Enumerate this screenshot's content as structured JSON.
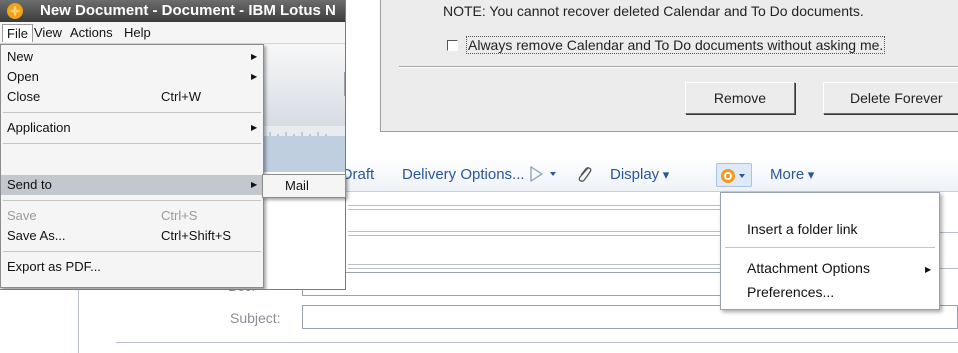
{
  "window": {
    "title": "New Document - Document - IBM Lotus N"
  },
  "menubar": {
    "items": [
      {
        "label": "File",
        "active": true
      },
      {
        "label": "View",
        "active": false
      },
      {
        "label": "Actions",
        "active": false
      },
      {
        "label": "Help",
        "active": false
      }
    ]
  },
  "file_menu": {
    "items": [
      {
        "label": "New",
        "shortcut": "",
        "submenu": true,
        "enabled": true
      },
      {
        "label": "Open",
        "shortcut": "",
        "submenu": true,
        "enabled": true
      },
      {
        "label": "Close",
        "shortcut": "Ctrl+W",
        "submenu": false,
        "enabled": true
      },
      {
        "label": "Application",
        "shortcut": "",
        "submenu": true,
        "enabled": true
      },
      {
        "label": "Send to",
        "shortcut": "",
        "submenu": true,
        "enabled": true,
        "highlighted": true
      },
      {
        "label": "Save",
        "shortcut": "Ctrl+S",
        "submenu": false,
        "enabled": false
      },
      {
        "label": "Save As...",
        "shortcut": "Ctrl+Shift+S",
        "submenu": false,
        "enabled": true
      },
      {
        "label": "Export as PDF...",
        "shortcut": "",
        "submenu": false,
        "enabled": true
      }
    ],
    "send_to_submenu": {
      "items": [
        {
          "label": "Mail"
        }
      ]
    }
  },
  "dialog": {
    "note": "NOTE: You cannot recover deleted Calendar and To Do documents.",
    "checkbox_label": "Always remove Calendar and To Do documents without asking me.",
    "checkbox_checked": false,
    "remove_button": "Remove",
    "delete_forever_button": "Delete Forever"
  },
  "mail_toolbar": {
    "draft_label": "s Draft",
    "delivery_options_label": "Delivery Options...",
    "display_label": "Display",
    "more_label": "More"
  },
  "mail_form": {
    "bcc_label": "Bcc:",
    "subject_label": "Subject:"
  },
  "more_menu": {
    "items": [
      {
        "label": "Insert a folder link",
        "submenu": false
      },
      {
        "label": "Attachment Options",
        "submenu": true
      },
      {
        "label": "Preferences...",
        "submenu": false
      }
    ]
  },
  "colors": {
    "toolbar_link": "#2b579a",
    "menu_highlight": "#c3c8cf",
    "titlebar": "#3b3b3b"
  }
}
